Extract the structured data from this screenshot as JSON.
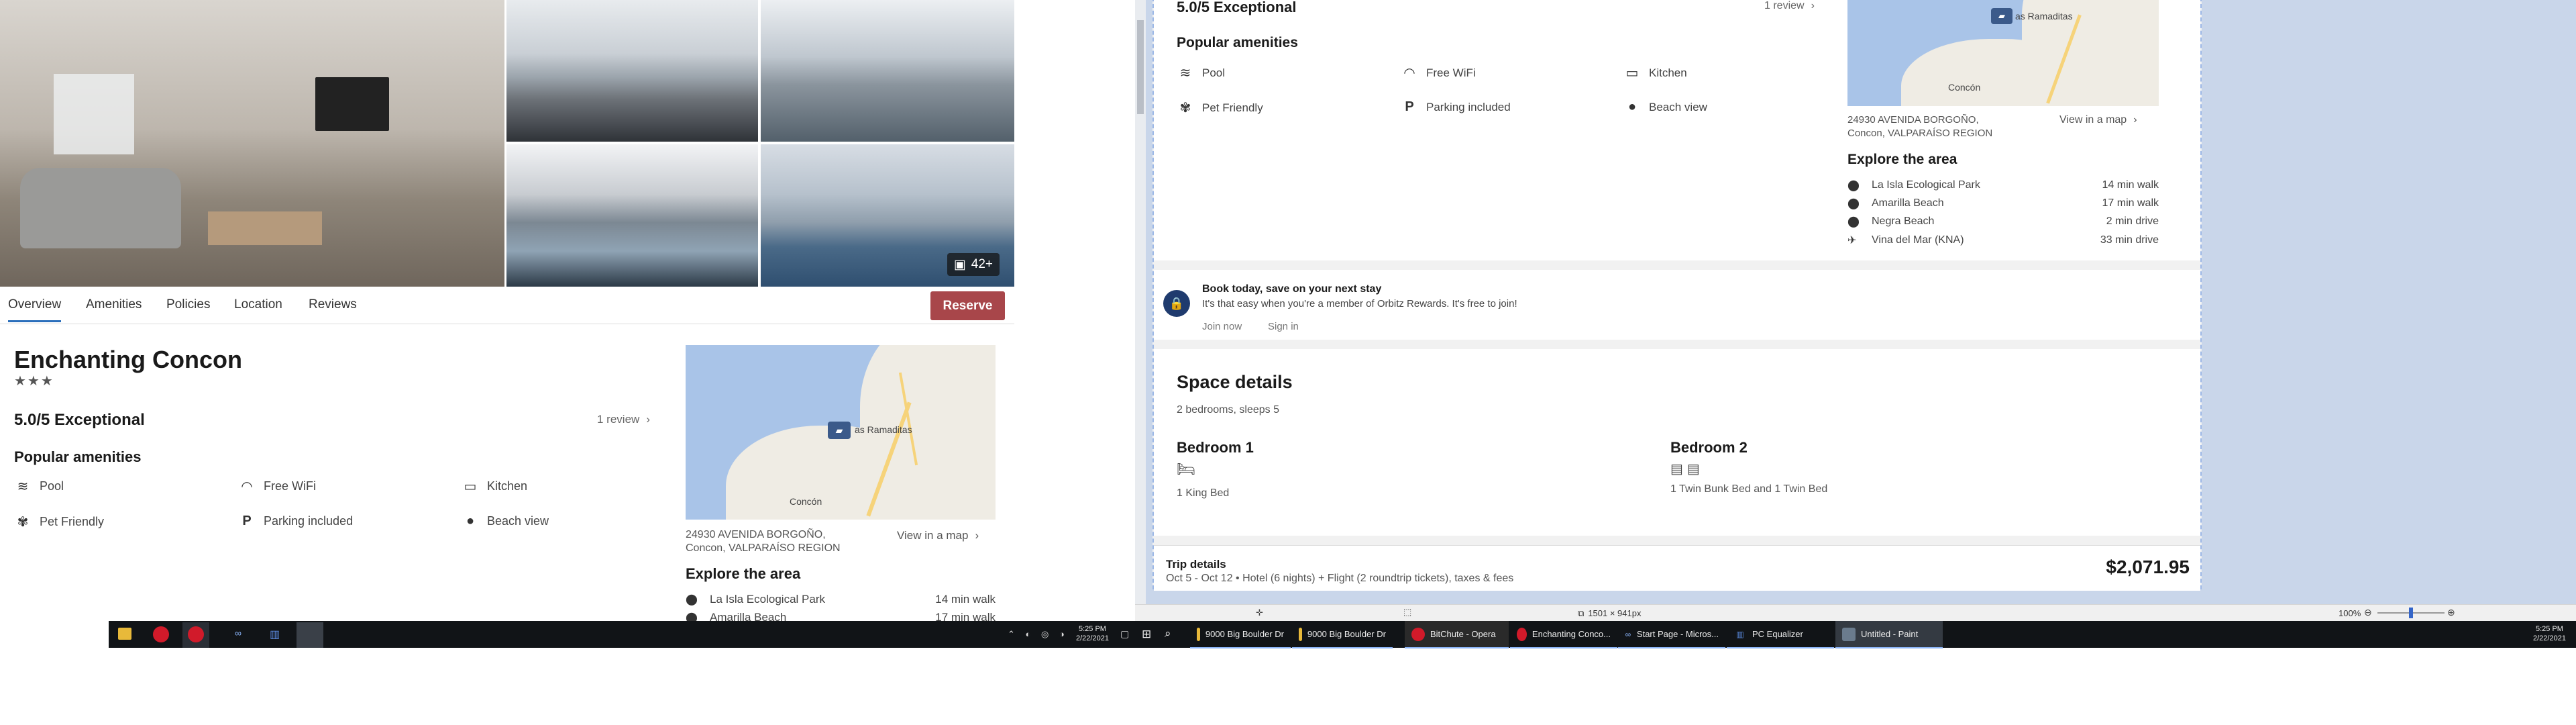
{
  "left": {
    "photo_count_badge": "42+",
    "tabs": [
      "Overview",
      "Amenities",
      "Policies",
      "Location",
      "Reviews"
    ],
    "reserve_label": "Reserve",
    "property_name": "Enchanting Concon",
    "stars": "★★★",
    "rating": "5.0/5 Exceptional",
    "review_link": "1 review",
    "amenities_title": "Popular amenities",
    "amenities": [
      {
        "icon": "pool-icon",
        "label": "Pool"
      },
      {
        "icon": "wifi-icon",
        "label": "Free WiFi"
      },
      {
        "icon": "kitchen-icon",
        "label": "Kitchen"
      },
      {
        "icon": "paw-icon",
        "label": "Pet Friendly"
      },
      {
        "icon": "parking-icon",
        "label": "Parking included"
      },
      {
        "icon": "water-drop-icon",
        "label": "Beach view"
      }
    ],
    "map": {
      "place": "as Ramaditas",
      "town": "Concón"
    },
    "address_line1": "24930 AVENIDA BORGOÑO,",
    "address_line2": "Concon, VALPARAÍSO REGION",
    "view_map": "View in a map",
    "explore_title": "Explore the area",
    "explore": [
      {
        "name": "La Isla Ecological Park",
        "dist": "14 min walk"
      },
      {
        "name": "Amarilla Beach",
        "dist": "17 min walk"
      }
    ]
  },
  "left_taskbar": {
    "time": "5:25 PM",
    "date": "2/22/2021"
  },
  "paint": {
    "rating": "5.0/5 Exceptional",
    "review_link": "1 review",
    "amenities_title": "Popular amenities",
    "amenities": [
      {
        "icon": "pool-icon",
        "label": "Pool"
      },
      {
        "icon": "wifi-icon",
        "label": "Free WiFi"
      },
      {
        "icon": "kitchen-icon",
        "label": "Kitchen"
      },
      {
        "icon": "paw-icon",
        "label": "Pet Friendly"
      },
      {
        "icon": "parking-icon",
        "label": "Parking included"
      },
      {
        "icon": "water-drop-icon",
        "label": "Beach view"
      }
    ],
    "map": {
      "place": "as Ramaditas",
      "town": "Concón"
    },
    "address_line1": "24930 AVENIDA BORGOÑO,",
    "address_line2": "Concon, VALPARAÍSO REGION",
    "view_map": "View in a map",
    "explore_title": "Explore the area",
    "explore": [
      {
        "icon": "pin-icon",
        "name": "La Isla Ecological Park",
        "dist": "14 min walk"
      },
      {
        "icon": "pin-icon",
        "name": "Amarilla Beach",
        "dist": "17 min walk"
      },
      {
        "icon": "pin-icon",
        "name": "Negra Beach",
        "dist": "2 min drive"
      },
      {
        "icon": "plane-icon",
        "name": "Vina del Mar (KNA)",
        "dist": "33 min drive"
      }
    ],
    "rewards_title": "Book today, save on your next stay",
    "rewards_text": "It's that easy when you're a member of Orbitz Rewards. It's free to join!",
    "join_now": "Join now",
    "sign_in": "Sign in",
    "space_title": "Space details",
    "space_sub": "2 bedrooms, sleeps 5",
    "bedroom1_title": "Bedroom 1",
    "bedroom1_beds": "1 King Bed",
    "bedroom2_title": "Bedroom 2",
    "bedroom2_beds": "1 Twin Bunk Bed and 1 Twin Bed",
    "trip_title": "Trip details",
    "trip_text": "Oct 5 - Oct 12 • Hotel (6 nights) + Flight (2 roundtrip tickets), taxes & fees",
    "trip_price": "$2,071.95",
    "status_size": "1501 × 941px",
    "zoom": "100%"
  },
  "right_taskbar": {
    "items": [
      "9000 Big Boulder Dr",
      "9000 Big Boulder Dr",
      "BitChute - Opera",
      "Enchanting Conco...",
      "Start Page - Micros...",
      "PC Equalizer",
      "Untitled - Paint"
    ],
    "time": "5:25 PM",
    "date": "2/22/2021"
  },
  "colors": {
    "accent": "#a8464a",
    "paint_bg": "#c9d6ea",
    "taskbar": "#111417"
  }
}
